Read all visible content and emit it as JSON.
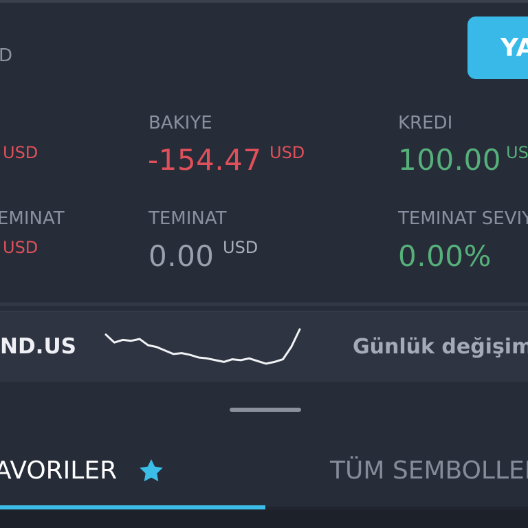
{
  "header": {
    "currency": "D",
    "deposit_label": "YA"
  },
  "account": {
    "col1_unit1": "USD",
    "col1_label2": "EMINAT",
    "col1_unit2": "USD",
    "balance": {
      "label": "BAKIYE",
      "value": "-154.47",
      "unit": "USD"
    },
    "credit": {
      "label": "KREDI",
      "value": "100.00",
      "unit": "US"
    },
    "margin": {
      "label": "TEMINAT",
      "value": "0.00",
      "unit": "USD"
    },
    "margin_level": {
      "label": "TEMINAT SEVIY",
      "value": "0.00%"
    }
  },
  "ticker": {
    "symbol": "ND.US",
    "daily_change_label": "Günlük değişim:",
    "sparkline": [
      [
        0,
        1.8
      ],
      [
        1,
        0.9
      ],
      [
        2,
        1.2
      ],
      [
        3,
        1.1
      ],
      [
        4,
        1.3
      ],
      [
        5,
        0.6
      ],
      [
        6,
        0.4
      ],
      [
        7,
        0.0
      ],
      [
        8,
        -0.4
      ],
      [
        9,
        -0.3
      ],
      [
        10,
        -0.5
      ],
      [
        11,
        -0.8
      ],
      [
        12,
        -0.9
      ],
      [
        13,
        -1.1
      ],
      [
        14,
        -1.3
      ],
      [
        15,
        -1.0
      ],
      [
        16,
        -1.1
      ],
      [
        17,
        -0.9
      ],
      [
        18,
        -1.2
      ],
      [
        19,
        -1.5
      ],
      [
        20,
        -1.3
      ],
      [
        21,
        -1.0
      ],
      [
        22,
        0.4
      ],
      [
        23,
        2.4
      ]
    ]
  },
  "tabs": {
    "favorites_label": "AVORILER",
    "all_symbols_label": "TÜM SEMBOLLER"
  },
  "colors": {
    "accent": "#3cbde8",
    "negative": "#e0505a",
    "positive": "#56b07a",
    "background": "#262c38"
  }
}
